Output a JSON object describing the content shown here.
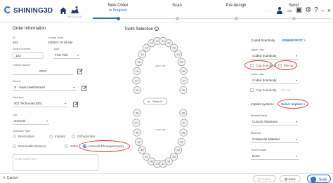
{
  "app": {
    "brand": "SHINING3D",
    "case_id": "##0-15:11:35"
  },
  "steps": [
    {
      "name": "New Order",
      "status": "In Progress"
    },
    {
      "name": "Scan",
      "status": ""
    },
    {
      "name": "Pre-design",
      "status": ""
    },
    {
      "name": "Send",
      "status": ""
    }
  ],
  "user": {
    "name": "—— ——"
  },
  "order": {
    "title": "Order Information",
    "id_label": "ID",
    "id_value": "103",
    "created_label": "Create Time",
    "created_value": "2/28/25 10:39 AM",
    "order_number_label": "Order Number",
    "order_number_value": "103",
    "type_label": "Type",
    "type_value": "First Visit",
    "patient_label": "Patient Name*",
    "patient_value": "####",
    "doctor_label": "Doctor",
    "doctor_value": "Isaac tawil/IsmaelI",
    "operator_label": "Operator",
    "operator_value": "001 Technician1001",
    "lab_label": "Lab",
    "lab_value": "General",
    "dentistry_label": "Dentistry Type",
    "dentistry_options": [
      "Restoration",
      "Implant",
      "Orthodontics",
      "Removable Denture",
      "Other",
      "Intraoral Photogrammetry"
    ],
    "notes_placeholder": "Enter Notes Here"
  },
  "teeth": {
    "title": "Tooth Selection",
    "upper_label": "Upper Jaw",
    "lower_label": "Lower Jaw",
    "show_all": "Show All",
    "upper": [
      "18",
      "17",
      "16",
      "15",
      "14",
      "13",
      "12",
      "11",
      "21",
      "22",
      "23",
      "24",
      "25",
      "26",
      "27",
      "28"
    ],
    "lower": [
      "48",
      "47",
      "46",
      "45",
      "44",
      "43",
      "42",
      "41",
      "31",
      "32",
      "33",
      "34",
      "35",
      "36",
      "37",
      "38"
    ]
  },
  "right": {
    "coded_label": "Coded Scanbody",
    "coded_link": "RN880FSPOT >",
    "upper_jaw_label": "Upper Jaw",
    "upper_jaw_value": "Coded Scanbody",
    "cap_scanbody": "Cap Scanbody",
    "pre_op": "Pre-op",
    "lower_jaw_label": "Lower Jaw",
    "lower_jaw_value": "Coded Scanbody",
    "cap_scanbody_lower": "Cap Scanbody",
    "pre_op_lower": "Pre-op",
    "implant_systems_label": "Implant systems",
    "select_implant": "Select Implant >",
    "implant_base_label": "Implant Base",
    "implant_base_value": "Custom Abutment",
    "material_label": "Material",
    "material_value": "Composite Material",
    "shade_label": "Tooth Shade",
    "shade_value": "None"
  },
  "bottom": {
    "cancel": "Cancel",
    "outline": "Outline",
    "save": "Save",
    "scan": "Scan"
  }
}
